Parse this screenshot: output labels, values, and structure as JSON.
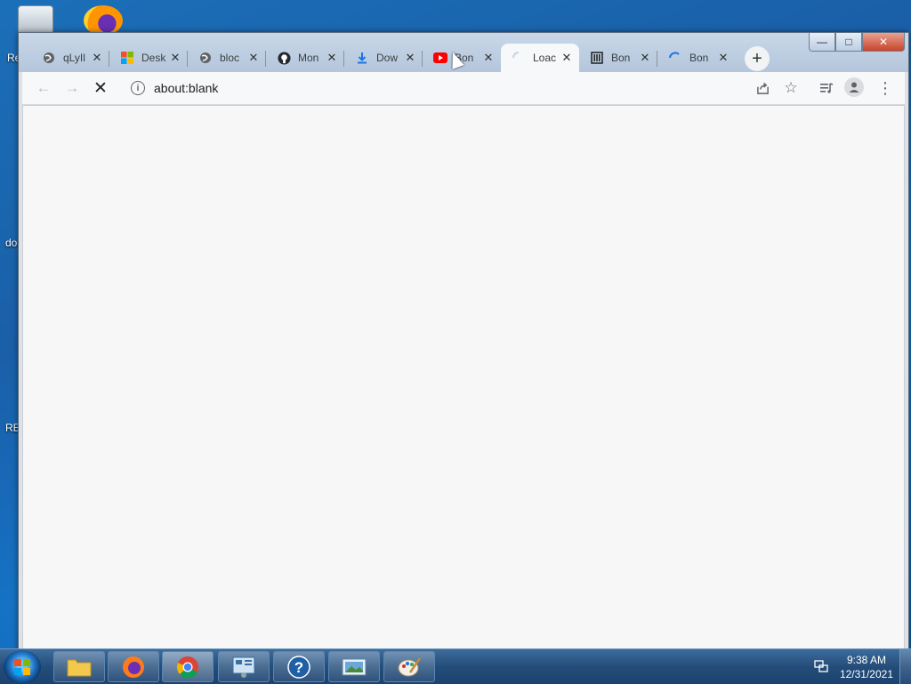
{
  "desktop": {
    "side_labels": [
      "Re",
      "do",
      "RE"
    ]
  },
  "window": {
    "controls": {
      "minimize": "—",
      "maximize": "□",
      "close": "✕"
    }
  },
  "tabs": [
    {
      "label": "qLyIl",
      "icon": "globe-icon",
      "active": false
    },
    {
      "label": "Desk",
      "icon": "microsoft-icon",
      "active": false
    },
    {
      "label": "bloc",
      "icon": "globe-icon",
      "active": false
    },
    {
      "label": "Mon",
      "icon": "github-icon",
      "active": false
    },
    {
      "label": "Dow",
      "icon": "download-icon",
      "active": false
    },
    {
      "label": "Bon",
      "icon": "youtube-icon",
      "active": false
    },
    {
      "label": "Loac",
      "icon": "loading-spinner-icon",
      "active": true
    },
    {
      "label": "Bon",
      "icon": "bank-icon",
      "active": false
    },
    {
      "label": "Bon",
      "icon": "loading-spinner-icon",
      "active": false
    }
  ],
  "toolbar": {
    "url": "about:blank"
  },
  "taskbar": {
    "items": [
      "file-explorer",
      "firefox",
      "chrome",
      "control-panel",
      "help",
      "photo-viewer",
      "paint"
    ],
    "time": "9:38 AM",
    "date": "12/31/2021"
  },
  "colors": {
    "accent": "#1a73e8",
    "youtube": "#ff0000"
  }
}
